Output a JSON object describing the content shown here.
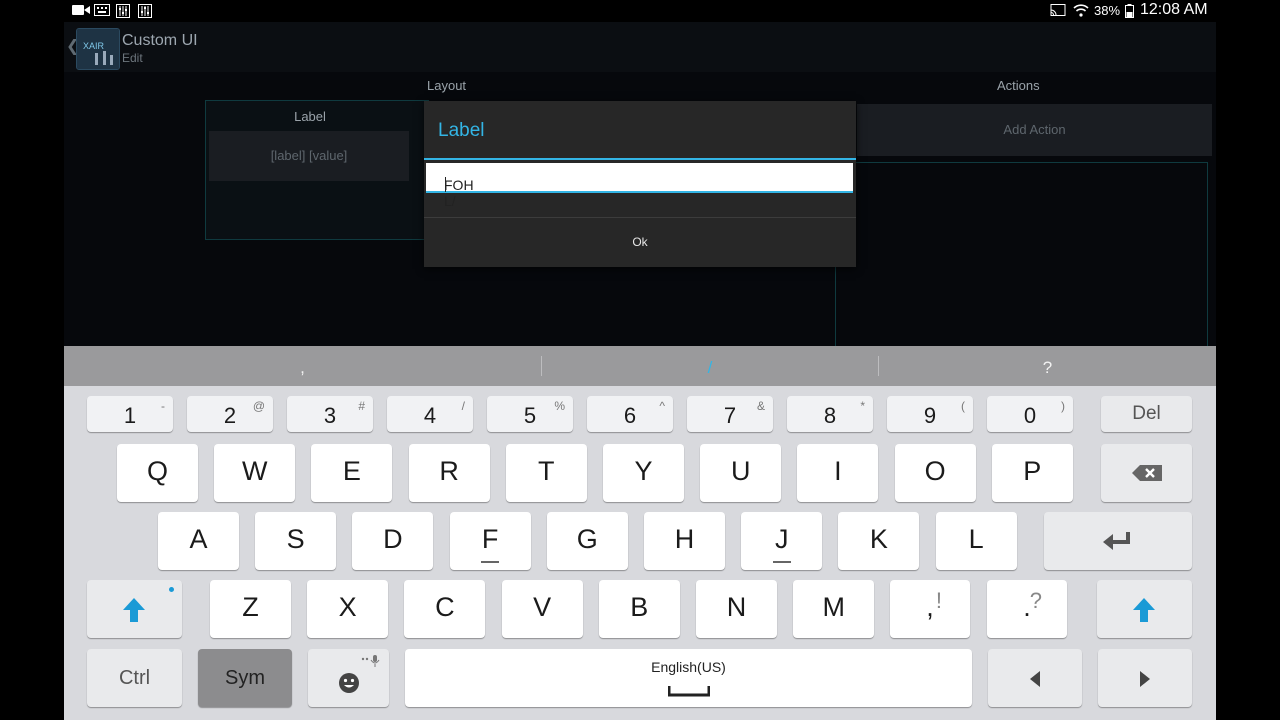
{
  "status_bar": {
    "battery": "38%",
    "time": "12:08 AM"
  },
  "app": {
    "title": "Custom UI",
    "subtitle": "Edit",
    "layout_header": "Layout",
    "actions_header": "Actions",
    "layout_label": "Label",
    "layout_value_placeholder": "[label] [value]",
    "add_action": "Add Action"
  },
  "dialog": {
    "title": "Label",
    "input_value": "FOH L/",
    "ok": "Ok"
  },
  "keyboard": {
    "suggestions": [
      ",",
      "/",
      "?"
    ],
    "number_row": [
      {
        "main": "1",
        "sup": "-"
      },
      {
        "main": "2",
        "sup": "@"
      },
      {
        "main": "3",
        "sup": "#"
      },
      {
        "main": "4",
        "sup": "/"
      },
      {
        "main": "5",
        "sup": "%"
      },
      {
        "main": "6",
        "sup": "^"
      },
      {
        "main": "7",
        "sup": "&"
      },
      {
        "main": "8",
        "sup": "*"
      },
      {
        "main": "9",
        "sup": "("
      },
      {
        "main": "0",
        "sup": ")"
      }
    ],
    "del": "Del",
    "row1": [
      "Q",
      "W",
      "E",
      "R",
      "T",
      "Y",
      "U",
      "I",
      "O",
      "P"
    ],
    "row2": [
      "A",
      "S",
      "D",
      "F",
      "G",
      "H",
      "J",
      "K",
      "L"
    ],
    "row3": [
      "Z",
      "X",
      "C",
      "V",
      "B",
      "N",
      "M"
    ],
    "comma_key": {
      "main": ",",
      "sup": "!"
    },
    "period_key": {
      "main": ".",
      "sup": "?"
    },
    "ctrl": "Ctrl",
    "sym": "Sym",
    "space_label": "English(US)",
    "colors": {
      "accent": "#33b5e5",
      "shift": "#1a9ad6"
    }
  }
}
